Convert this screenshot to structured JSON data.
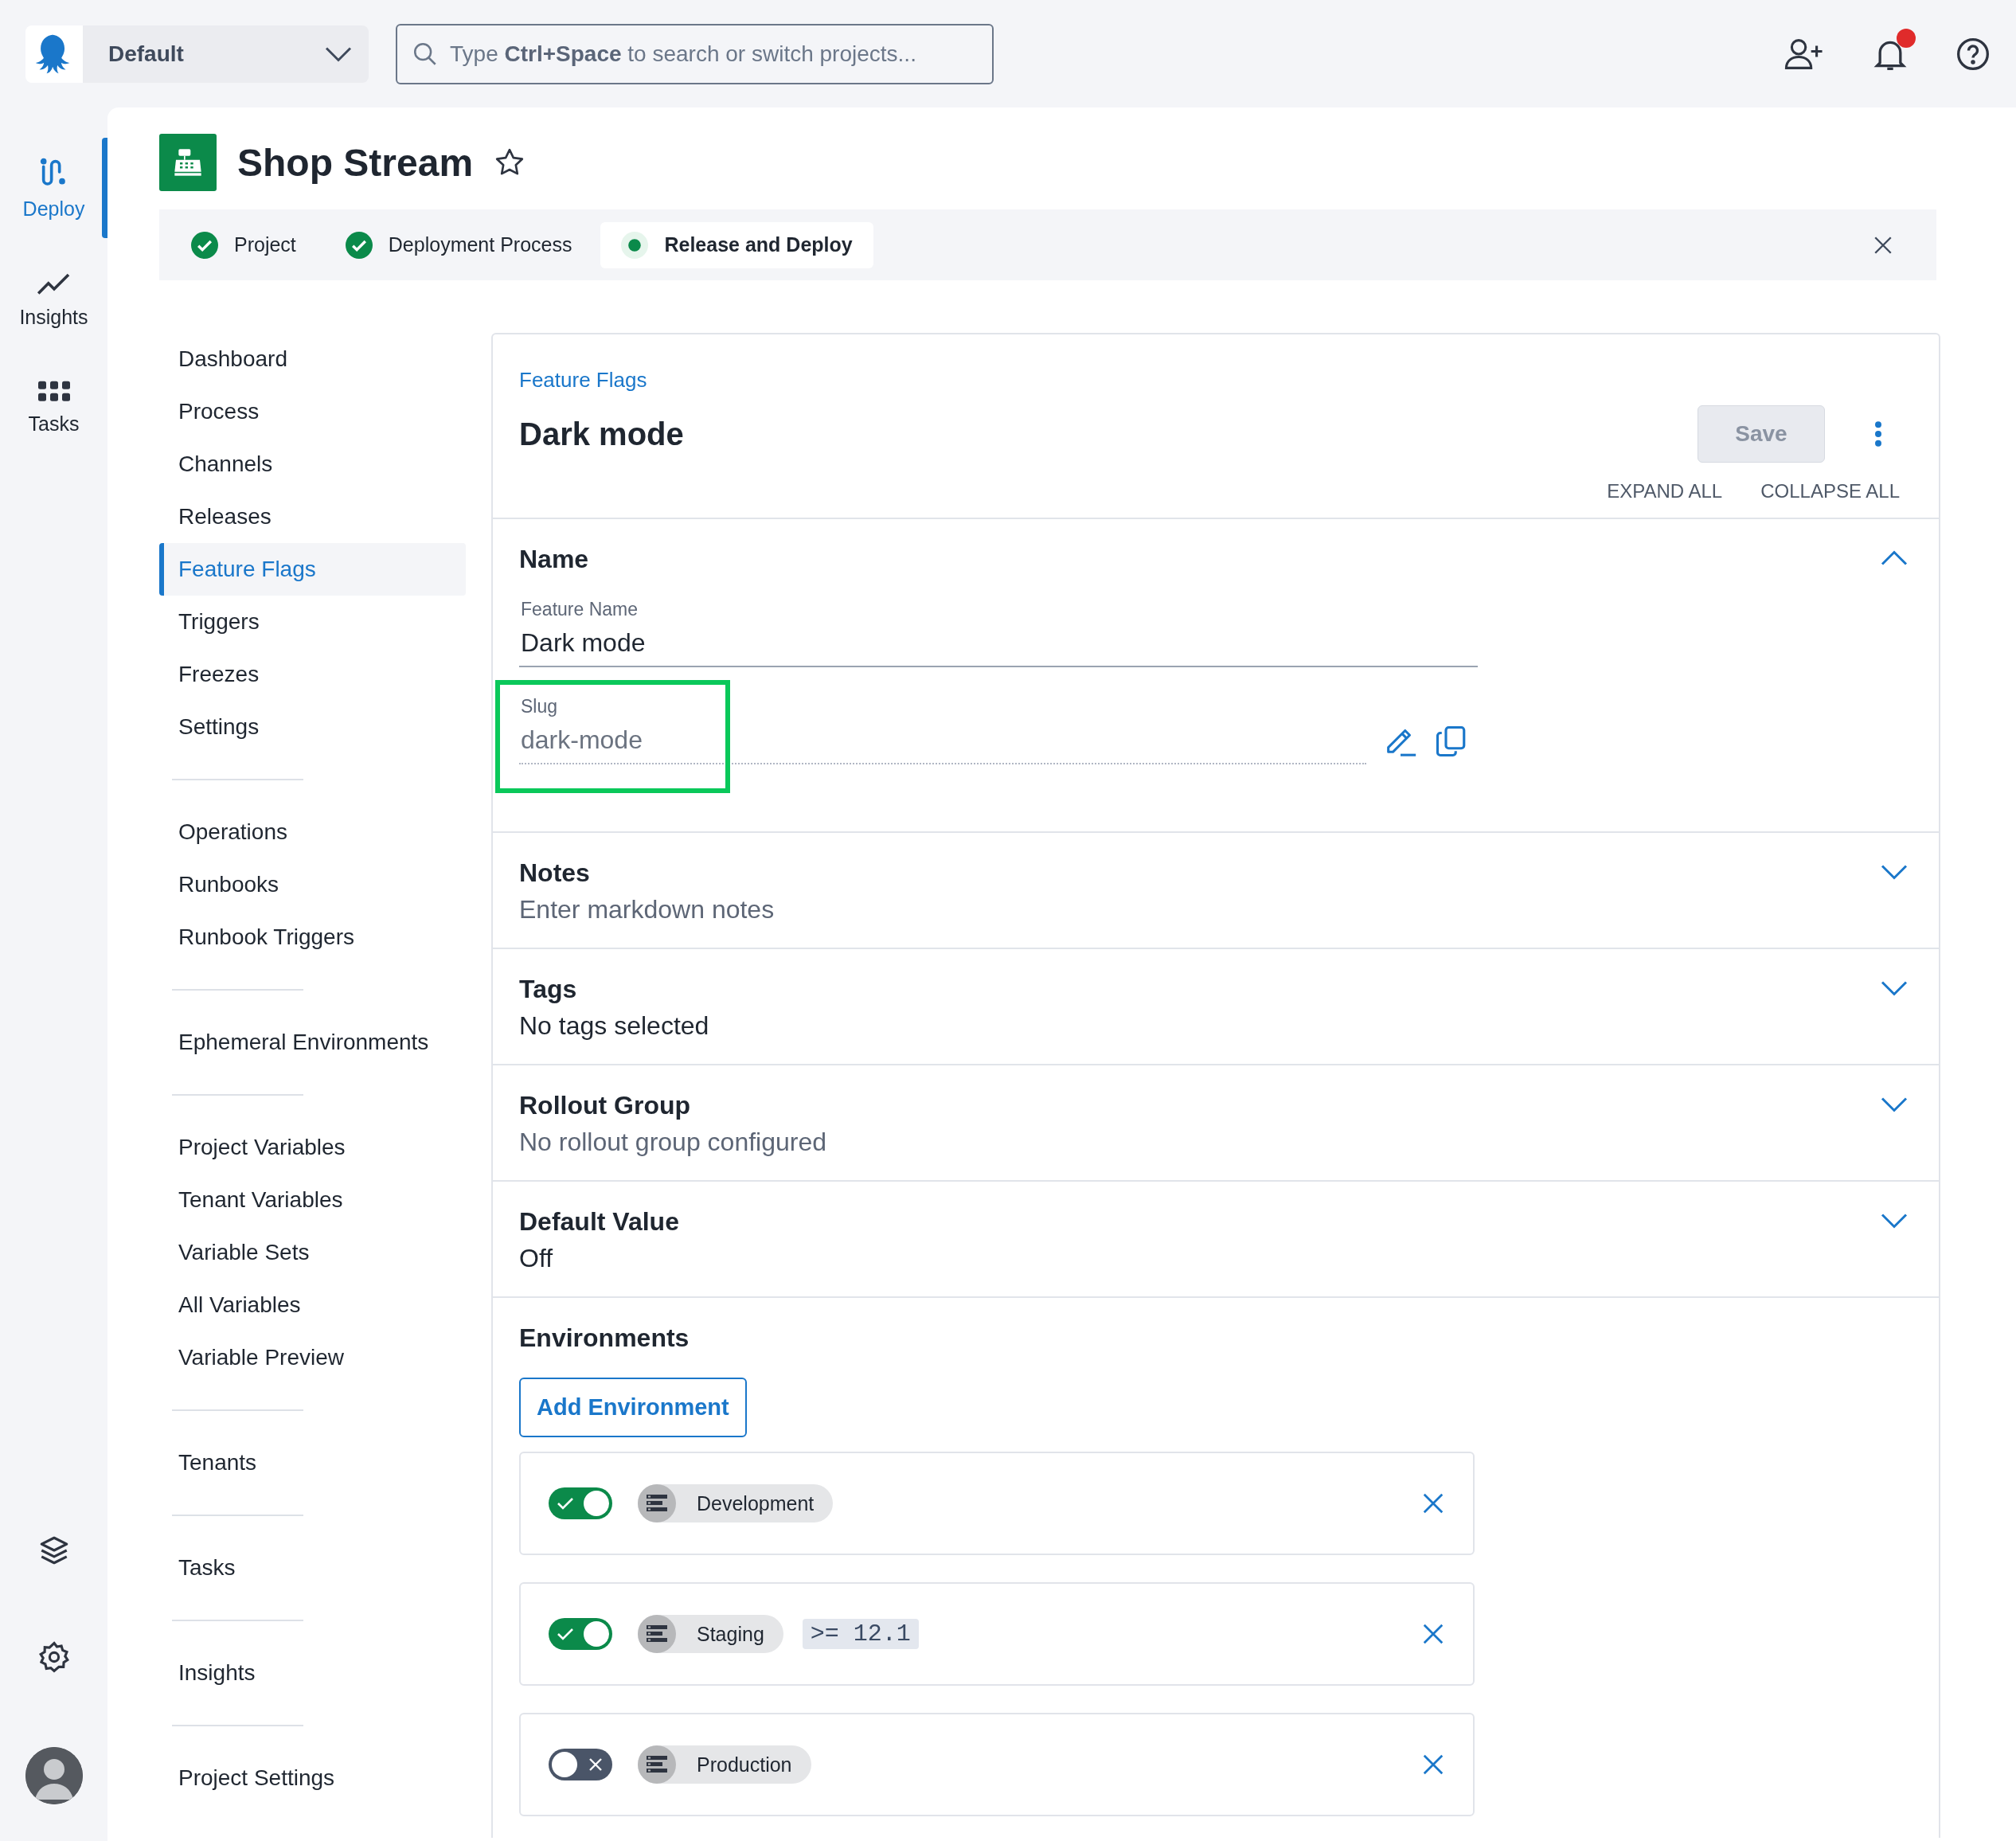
{
  "top_bar": {
    "workspace": "Default",
    "search": {
      "placeholder": "Type **Ctrl+Space** to search or switch projects..."
    },
    "notifications": {
      "unread": true
    }
  },
  "rail": {
    "items": [
      {
        "label": "Deploy",
        "kind": "deploy",
        "selected": true
      },
      {
        "label": "Insights",
        "kind": "insights",
        "selected": false
      },
      {
        "label": "Tasks",
        "kind": "tasks",
        "selected": false
      }
    ]
  },
  "project": {
    "title": "Shop Stream",
    "starred": false
  },
  "steps": [
    {
      "label": "Project",
      "kind": "done"
    },
    {
      "label": "Deployment Process",
      "kind": "done"
    },
    {
      "label": "Release and Deploy",
      "kind": "current"
    }
  ],
  "sidebar": {
    "groups": [
      [
        {
          "label": "Dashboard",
          "selected": false
        },
        {
          "label": "Process",
          "selected": false
        },
        {
          "label": "Channels",
          "selected": false
        },
        {
          "label": "Releases",
          "selected": false
        },
        {
          "label": "Feature Flags",
          "selected": true
        },
        {
          "label": "Triggers",
          "selected": false
        },
        {
          "label": "Freezes",
          "selected": false
        },
        {
          "label": "Settings",
          "selected": false
        }
      ],
      [
        {
          "label": "Operations",
          "selected": false
        },
        {
          "label": "Runbooks",
          "selected": false
        },
        {
          "label": "Runbook Triggers",
          "selected": false
        }
      ],
      [
        {
          "label": "Ephemeral Environments",
          "selected": false
        }
      ],
      [
        {
          "label": "Project Variables",
          "selected": false
        },
        {
          "label": "Tenant Variables",
          "selected": false
        },
        {
          "label": "Variable Sets",
          "selected": false
        },
        {
          "label": "All Variables",
          "selected": false
        },
        {
          "label": "Variable Preview",
          "selected": false
        }
      ],
      [
        {
          "label": "Tenants",
          "selected": false
        }
      ],
      [
        {
          "label": "Tasks",
          "selected": false
        }
      ],
      [
        {
          "label": "Insights",
          "selected": false
        }
      ],
      [
        {
          "label": "Project Settings",
          "selected": false
        }
      ]
    ]
  },
  "panel": {
    "breadcrumb": "Feature Flags",
    "title": "Dark mode",
    "save": {
      "label": "Save",
      "disabled": true
    },
    "expand_all": "EXPAND ALL",
    "collapse_all": "COLLAPSE ALL",
    "sections": [
      {
        "kind": "name",
        "title": "Name",
        "expanded": true,
        "feature_name": {
          "label": "Feature Name",
          "value": "Dark mode"
        },
        "slug": {
          "label": "Slug",
          "value": "dark-mode",
          "highlighted": true
        }
      },
      {
        "kind": "summary",
        "title": "Notes",
        "summary": "Enter markdown notes",
        "muted": true,
        "expanded": false
      },
      {
        "kind": "summary",
        "title": "Tags",
        "summary": "No tags selected",
        "muted": false,
        "expanded": false
      },
      {
        "kind": "summary",
        "title": "Rollout Group",
        "summary": "No rollout group configured",
        "muted": true,
        "expanded": false
      },
      {
        "kind": "summary",
        "title": "Default Value",
        "summary": "Off",
        "muted": false,
        "expanded": false
      },
      {
        "kind": "environments",
        "title": "Environments",
        "add_button": "Add Environment",
        "items": [
          {
            "name": "Development",
            "enabled": true
          },
          {
            "name": "Staging",
            "enabled": true,
            "condition": ">= 12.1"
          },
          {
            "name": "Production",
            "enabled": false
          }
        ]
      }
    ]
  }
}
